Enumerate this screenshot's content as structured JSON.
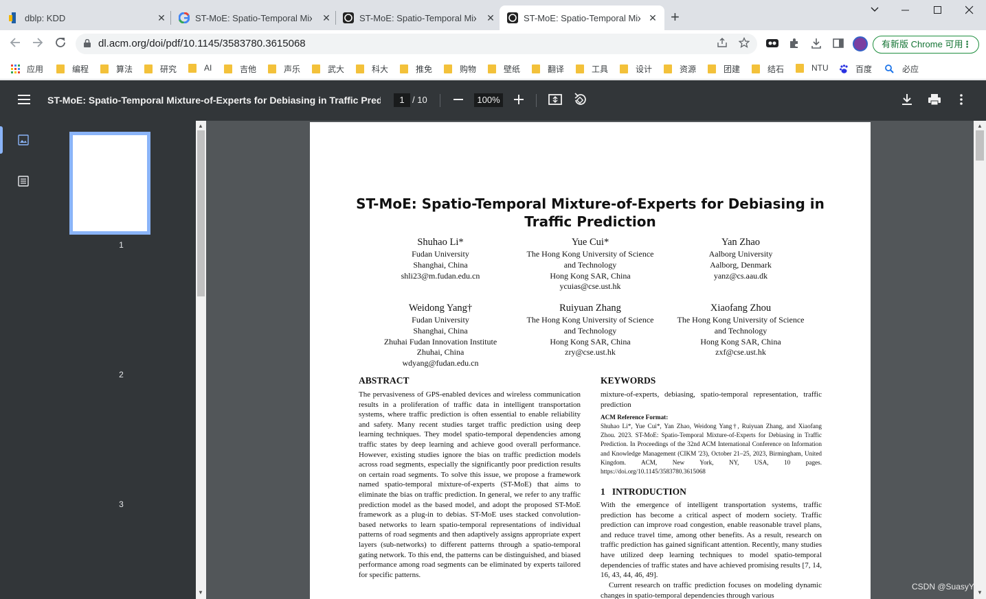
{
  "browser": {
    "tabs": [
      {
        "title": "dblp: KDD",
        "favicon": "dblp-icon"
      },
      {
        "title": "ST-MoE: Spatio-Temporal Mix",
        "favicon": "google-icon"
      },
      {
        "title": "ST-MoE: Spatio-Temporal Mix",
        "favicon": "acm-icon"
      },
      {
        "title": "ST-MoE: Spatio-Temporal Mix",
        "favicon": "acm-icon"
      }
    ],
    "new_tab": "+",
    "url": "dl.acm.org/doi/pdf/10.1145/3583780.3615068",
    "update_label": "有新版 Chrome 可用",
    "bookmarks": [
      "应用",
      "编程",
      "算法",
      "研究",
      "AI",
      "吉他",
      "声乐",
      "武大",
      "科大",
      "推免",
      "购物",
      "壁纸",
      "翻译",
      "工具",
      "设计",
      "资源",
      "团建",
      "结石",
      "NTU",
      "百度",
      "必应"
    ]
  },
  "pdf": {
    "title": "ST-MoE: Spatio-Temporal Mixture-of-Experts for Debiasing in Traffic Predi...",
    "current_page": "1",
    "total_pages": "/ 10",
    "zoom": "100%",
    "thumb_numbers": [
      "1",
      "2",
      "3"
    ]
  },
  "paper": {
    "title": "ST-MoE: Spatio-Temporal Mixture-of-Experts for Debiasing in Traffic Prediction",
    "authors": [
      {
        "name": "Shuhao Li*",
        "lines": [
          "Fudan University",
          "Shanghai, China",
          "shli23@m.fudan.edu.cn"
        ]
      },
      {
        "name": "Yue Cui*",
        "lines": [
          "The Hong Kong University of Science",
          "and Technology",
          "Hong Kong SAR, China",
          "ycuias@cse.ust.hk"
        ]
      },
      {
        "name": "Yan Zhao",
        "lines": [
          "Aalborg University",
          "Aalborg, Denmark",
          "yanz@cs.aau.dk"
        ]
      },
      {
        "name": "Weidong Yang†",
        "lines": [
          "Fudan University",
          "Shanghai, China",
          "Zhuhai Fudan Innovation Institute",
          "Zhuhai, China",
          "wdyang@fudan.edu.cn"
        ]
      },
      {
        "name": "Ruiyuan Zhang",
        "lines": [
          "The Hong Kong University of Science",
          "and Technology",
          "Hong Kong SAR, China",
          "zry@cse.ust.hk"
        ]
      },
      {
        "name": "Xiaofang Zhou",
        "lines": [
          "The Hong Kong University of Science",
          "and Technology",
          "Hong Kong SAR, China",
          "zxf@cse.ust.hk"
        ]
      }
    ],
    "abstract_heading": "ABSTRACT",
    "abstract": "The pervasiveness of GPS-enabled devices and wireless communication results in a proliferation of traffic data in intelligent transportation systems, where traffic prediction is often essential to enable reliability and safety. Many recent studies target traffic prediction using deep learning techniques. They model spatio-temporal dependencies among traffic states by deep learning and achieve good overall performance. However, existing studies ignore the bias on traffic prediction models across road segments, especially the significantly poor prediction results on certain road segments. To solve this issue, we propose a framework named spatio-temporal mixture-of-experts (ST-MoE) that aims to eliminate the bias on traffic prediction. In general, we refer to any traffic prediction model as the based model, and adopt the proposed ST-MoE framework as a plug-in to debias. ST-MoE uses stacked convolution-based networks to learn spatio-temporal representations of individual patterns of road segments and then adaptively assigns appropriate expert layers (sub-networks) to different patterns through a spatio-temporal gating network. To this end, the patterns can be distinguished, and biased performance among road segments can be eliminated by experts tailored for specific patterns.",
    "keywords_heading": "KEYWORDS",
    "keywords": "mixture-of-experts, debiasing, spatio-temporal representation, traffic prediction",
    "acm_ref_heading": "ACM Reference Format:",
    "acm_ref": "Shuhao Li*, Yue Cui*, Yan Zhao, Weidong Yang†, Ruiyuan Zhang, and Xiaofang Zhou. 2023. ST-MoE: Spatio-Temporal Mixture-of-Experts for Debiasing in Traffic Prediction. In Proceedings of the 32nd ACM International Conference on Information and Knowledge Management (CIKM '23), October 21–25, 2023, Birmingham, United Kingdom. ACM, New York, NY, USA, 10 pages. https://doi.org/10.1145/3583780.3615068",
    "intro_heading": "1   INTRODUCTION",
    "intro_p1": "With the emergence of intelligent transportation systems, traffic prediction has become a critical aspect of modern society. Traffic prediction can improve road congestion, enable reasonable travel plans, and reduce travel time, among other benefits. As a result, research on traffic prediction has gained significant attention. Recently, many studies have utilized deep learning techniques to model spatio-temporal dependencies of traffic states and have achieved promising results [7, 14, 16, 43, 44, 46, 49].",
    "intro_p2": "Current research on traffic prediction focuses on modeling dynamic changes in spatio-temporal dependencies through various"
  },
  "watermark": "CSDN @SuasyYi"
}
